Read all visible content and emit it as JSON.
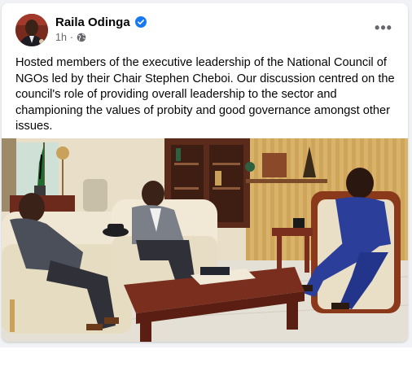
{
  "post": {
    "author": "Raila Odinga",
    "verified_icon": "verified-badge-icon",
    "timestamp": "1h",
    "separator": "·",
    "audience_icon": "globe-icon",
    "more_icon": "more-options-icon",
    "more_label": "•••",
    "text": "Hosted members of the executive leadership of the National Council of NGOs led by their Chair Stephen Cheboi. Our discussion centred on the council's role of providing overall leadership to the sector and championing the values of probity and good governance amongst other issues."
  },
  "colors": {
    "verified_blue": "#1877f2",
    "secondary_text": "#65676b",
    "sofa_cream": "#efe7d4",
    "table_wood": "#7a2e1e",
    "wall_tan": "#d9b36a",
    "bookcase_wood": "#5a2a1a",
    "flag_green": "#1f6b2f"
  }
}
